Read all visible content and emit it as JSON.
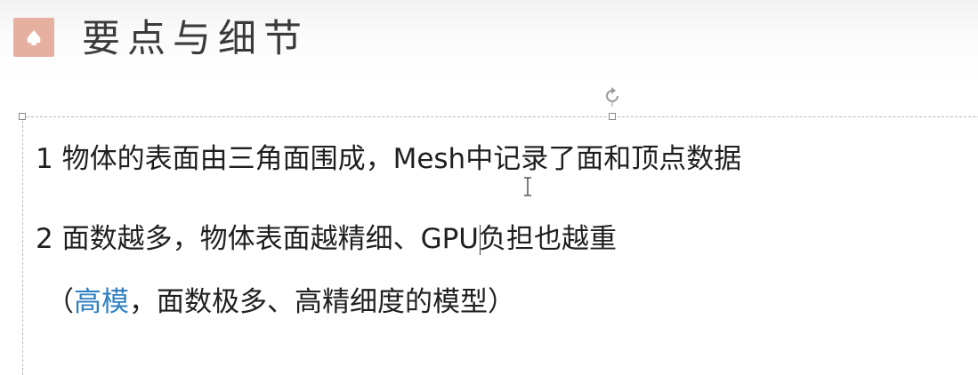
{
  "slide": {
    "title": "要点与细节",
    "title_icon": "spade-badge-icon",
    "accent_color": "#e6b0a0",
    "highlight_color": "#2f7fc1",
    "bullets": [
      {
        "text": "1 物体的表面由三角面围成，Mesh中记录了面和顶点数据"
      },
      {
        "text": "2 面数越多，物体表面越精细、GPU负担也越重"
      },
      {
        "open_paren": "（",
        "highlight": "高模",
        "rest": "，面数极多、高精细度的模型",
        "close_paren": "）"
      }
    ]
  }
}
